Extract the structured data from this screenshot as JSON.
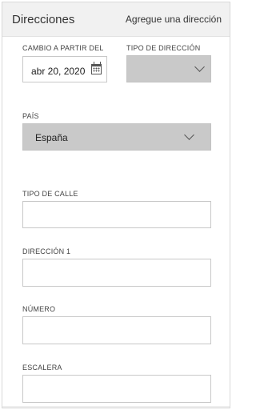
{
  "header": {
    "title": "Direcciones",
    "add_link": "Agregue una dirección"
  },
  "form": {
    "effective_date": {
      "label": "CAMBIO A PARTIR DEL",
      "value": "abr 20, 2020",
      "icon": "calendar-icon"
    },
    "address_type": {
      "label": "TIPO DE DIRECCIÓN",
      "value": "",
      "icon": "chevron-down-icon"
    },
    "country": {
      "label": "PAÍS",
      "value": "España",
      "icon": "chevron-down-icon"
    },
    "street_type": {
      "label": "TIPO DE CALLE",
      "value": ""
    },
    "address_1": {
      "label": "DIRECCIÓN 1",
      "value": ""
    },
    "number": {
      "label": "NÚMERO",
      "value": ""
    },
    "staircase": {
      "label": "ESCALERA",
      "value": ""
    }
  },
  "colors": {
    "header_bg": "#f1f1f1",
    "select_bg": "#c9c9c9",
    "field_border": "#c8c8c8"
  }
}
